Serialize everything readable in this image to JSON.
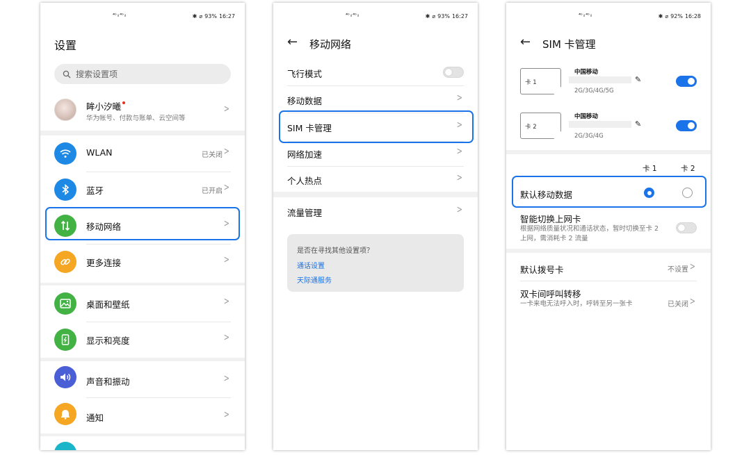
{
  "screen1": {
    "status": {
      "signal": "⁴ᴳ ᵢₗ ⁴ᴳ ᵢₗ",
      "battery": "93%",
      "time": "16:27"
    },
    "title": "设置",
    "search_placeholder": "搜索设置项",
    "profile": {
      "name": "眸小汐曦",
      "subtitle": "华为帐号、付款与账单、云空间等"
    },
    "items": [
      {
        "label": "WLAN",
        "value": "已关闭"
      },
      {
        "label": "蓝牙",
        "value": "已开启"
      },
      {
        "label": "移动网络",
        "value": ""
      },
      {
        "label": "更多连接",
        "value": ""
      },
      {
        "label": "桌面和壁纸",
        "value": ""
      },
      {
        "label": "显示和亮度",
        "value": ""
      },
      {
        "label": "声音和振动",
        "value": ""
      },
      {
        "label": "通知",
        "value": ""
      }
    ],
    "colors": {
      "wlan": "#1e88e5",
      "bluetooth": "#1e88e5",
      "mobile": "#43b244",
      "more": "#f5a623",
      "desktop": "#43b244",
      "display": "#43b244",
      "sound": "#4a5ed6",
      "notify": "#f5a623",
      "highlight": "#1a73e8"
    }
  },
  "screen2": {
    "status": {
      "signal": "⁴ᴳ ᵢₗ ⁴ᴳ ᵢₗ",
      "battery": "93%",
      "time": "16:27"
    },
    "title": "移动网络",
    "items": [
      {
        "label": "飞行模式"
      },
      {
        "label": "移动数据"
      },
      {
        "label": "SIM 卡管理"
      },
      {
        "label": "网络加速"
      },
      {
        "label": "个人热点"
      },
      {
        "label": "流量管理"
      }
    ],
    "suggest": {
      "question": "是否在寻找其他设置项？",
      "link1": "通话设置",
      "link2": "天际通服务"
    }
  },
  "screen3": {
    "status": {
      "signal": "⁴ᴳ ᵢₗ ⁴ᴳ ᵢₗ",
      "battery": "92%",
      "time": "16:28"
    },
    "title": "SIM 卡管理",
    "sims": [
      {
        "label": "卡 1",
        "carrier": "中国移动",
        "bands": "2G/3G/4G/5G",
        "enabled": true
      },
      {
        "label": "卡 2",
        "carrier": "中国移动",
        "bands": "2G/3G/4G",
        "enabled": true
      }
    ],
    "col_headers": [
      "卡 1",
      "卡 2"
    ],
    "default_data": {
      "label": "默认移动数据",
      "selected": "卡 1"
    },
    "smart_switch": {
      "label": "智能切换上网卡",
      "desc": "根据网络质量状况和通话状态，暂时切换至卡 2 上网，需消耗卡 2 流量",
      "enabled": false
    },
    "default_call": {
      "label": "默认拨号卡",
      "value": "不设置"
    },
    "call_forward": {
      "label": "双卡间呼叫转移",
      "desc": "一卡来电无法呼入时，呼转至另一张卡",
      "value": "已关闭"
    }
  }
}
